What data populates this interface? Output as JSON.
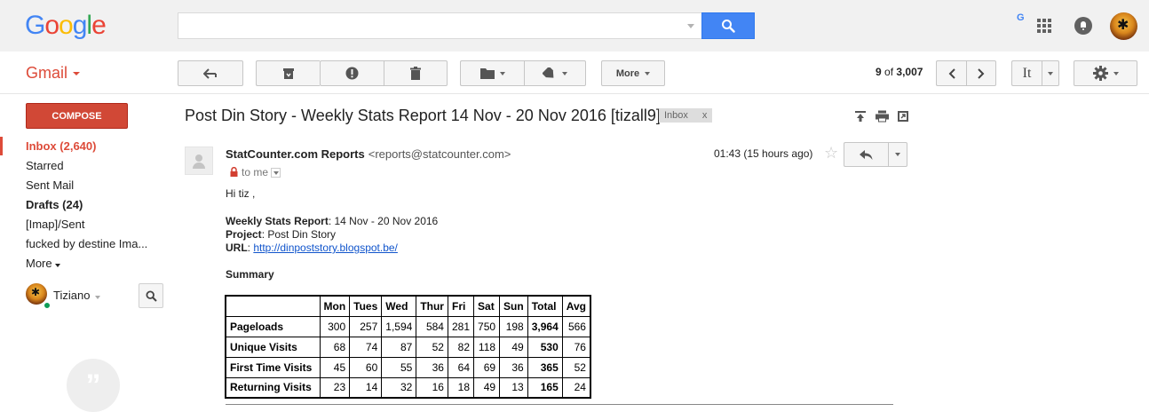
{
  "header": {
    "logo_letters": [
      {
        "ch": "G",
        "color": "#4285f4"
      },
      {
        "ch": "o",
        "color": "#ea4335"
      },
      {
        "ch": "o",
        "color": "#fbbc05"
      },
      {
        "ch": "g",
        "color": "#4285f4"
      },
      {
        "ch": "l",
        "color": "#34a853"
      },
      {
        "ch": "e",
        "color": "#ea4335"
      }
    ],
    "search_value": "",
    "g_dot": "G"
  },
  "toolbar": {
    "app_label": "Gmail",
    "more_label": "More",
    "pager_current": "9",
    "pager_of": "of",
    "pager_total": "3,007",
    "input_tools_label": "It"
  },
  "nav": {
    "compose": "COMPOSE",
    "items": [
      {
        "label": "Inbox (2,640)",
        "style": "active"
      },
      {
        "label": "Starred",
        "style": ""
      },
      {
        "label": "Sent Mail",
        "style": ""
      },
      {
        "label": "Drafts (24)",
        "style": "bold"
      },
      {
        "label": "[Imap]/Sent",
        "style": ""
      },
      {
        "label": "fucked by destine Ima...",
        "style": ""
      },
      {
        "label": "More",
        "style": ""
      }
    ],
    "hangouts_user": "Tiziano",
    "quote_glyph": "”"
  },
  "message": {
    "subject": "Post Din Story - Weekly Stats Report 14 Nov - 20 Nov 2016 [tizall9]",
    "tag_label": "Inbox",
    "tag_close": "x",
    "sender_name": "StatCounter.com Reports",
    "sender_email": "<reports@statcounter.com>",
    "to_label": "to me",
    "time": "01:43 (15 hours ago)",
    "greeting": "Hi tiz ,",
    "report_label": "Weekly Stats Report",
    "report_value": ": 14 Nov - 20 Nov 2016",
    "project_label": "Project",
    "project_value": ": Post Din Story",
    "url_label": "URL",
    "url_sep": ": ",
    "url_value": "http://dinpoststory.blogspot.be/",
    "summary_heading": "Summary"
  },
  "stats_table": {
    "headers": [
      "",
      "Mon",
      "Tues",
      "Wed",
      "Thur",
      "Fri",
      "Sat",
      "Sun",
      "Total",
      "Avg"
    ],
    "rows": [
      {
        "label": "Pageloads",
        "values": [
          "300",
          "257",
          "1,594",
          "584",
          "281",
          "750",
          "198",
          "3,964",
          "566"
        ]
      },
      {
        "label": "Unique Visits",
        "values": [
          "68",
          "74",
          "87",
          "52",
          "82",
          "118",
          "49",
          "530",
          "76"
        ]
      },
      {
        "label": "First Time Visits",
        "values": [
          "45",
          "60",
          "55",
          "36",
          "64",
          "69",
          "36",
          "365",
          "52"
        ]
      },
      {
        "label": "Returning Visits",
        "values": [
          "23",
          "14",
          "32",
          "16",
          "18",
          "49",
          "13",
          "165",
          "24"
        ]
      }
    ]
  },
  "colors": {
    "gmail_red": "#dd4b39",
    "compose_red": "#d14836",
    "search_blue": "#4285f4",
    "link_blue": "#1155cc",
    "online_green": "#0f9d58"
  }
}
